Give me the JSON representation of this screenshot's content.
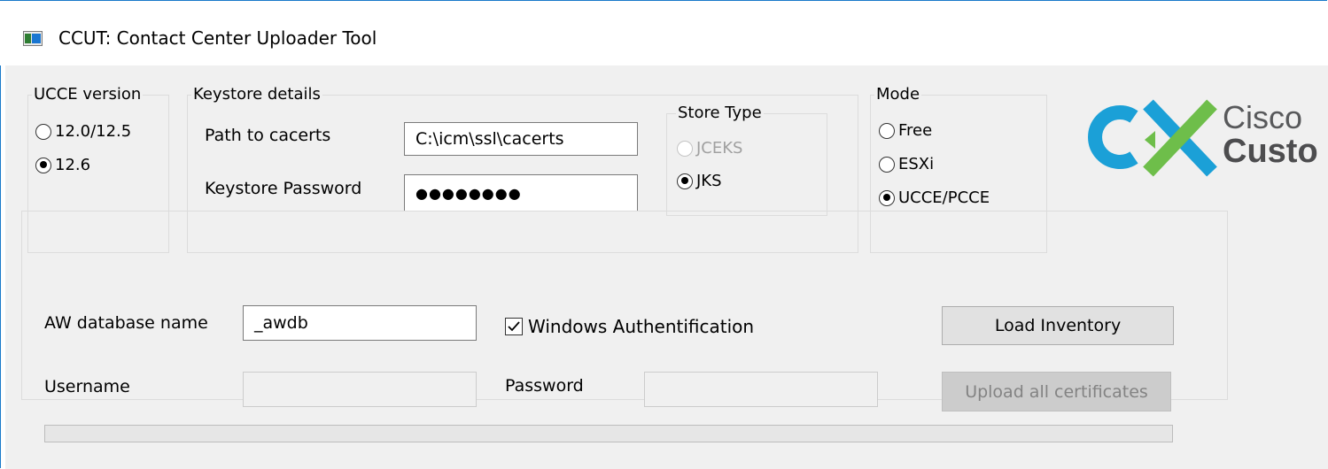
{
  "window": {
    "title": "CCUT: Contact Center Uploader Tool",
    "icon": "app-window-icon",
    "accent_color": "#1979ca"
  },
  "ucce_version": {
    "legend": "UCCE version",
    "options": [
      {
        "label": "12.0/12.5",
        "checked": false
      },
      {
        "label": "12.6",
        "checked": true
      }
    ]
  },
  "keystore": {
    "legend": "Keystore details",
    "path_label": "Path to cacerts",
    "path_value": "C:\\icm\\ssl\\cacerts",
    "password_label": "Keystore Password",
    "password_value": "●●●●●●●●"
  },
  "store_type": {
    "legend": "Store Type",
    "options": [
      {
        "label": "JCEKS",
        "checked": false,
        "disabled": true
      },
      {
        "label": "JKS",
        "checked": true,
        "disabled": false
      }
    ]
  },
  "mode": {
    "legend": "Mode",
    "options": [
      {
        "label": "Free",
        "checked": false
      },
      {
        "label": "ESXi",
        "checked": false
      },
      {
        "label": "UCCE/PCCE",
        "checked": true
      }
    ]
  },
  "logo": {
    "mark": "CX",
    "word1": "Cisco",
    "word2": "Custo",
    "colors": {
      "blue": "#1ba0d7",
      "green": "#6ebe4a",
      "gray": "#58595b"
    }
  },
  "database": {
    "aw_label": "AW database name",
    "aw_value": "_awdb",
    "windows_auth_label": "Windows Authentification",
    "windows_auth_checked": true,
    "username_label": "Username",
    "username_value": "",
    "password_label": "Password",
    "password_value": "",
    "load_button": "Load Inventory",
    "upload_button": "Upload all certificates",
    "upload_enabled": false
  },
  "progress": {
    "value": 0
  }
}
